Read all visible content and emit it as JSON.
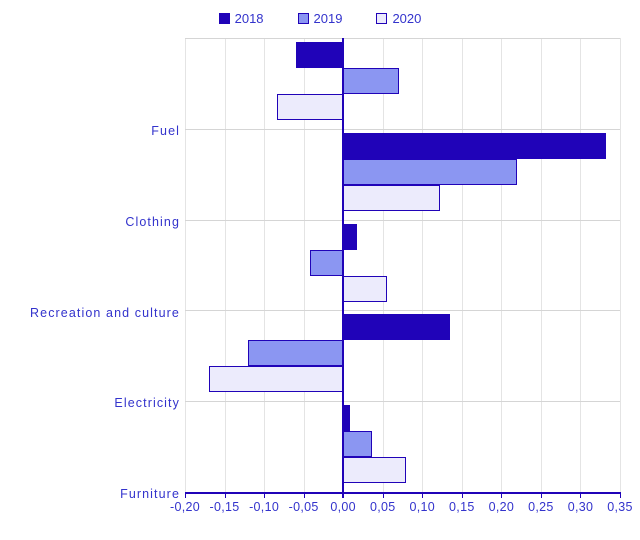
{
  "chart_data": {
    "type": "bar",
    "orientation": "horizontal",
    "title": "",
    "subtitle": "",
    "xlabel": "",
    "ylabel": "",
    "grid": true,
    "legend_position": "top-center",
    "xlim": [
      -0.2,
      0.35
    ],
    "xtick_step": 0.05,
    "xtick_labels": [
      "-0,20",
      "-0,15",
      "-0,10",
      "-0,05",
      "0,00",
      "0,05",
      "0,10",
      "0,15",
      "0,20",
      "0,25",
      "0,30",
      "0,35"
    ],
    "xtick_values": [
      -0.2,
      -0.15,
      -0.1,
      -0.05,
      0.0,
      0.05,
      0.1,
      0.15,
      0.2,
      0.25,
      0.3,
      0.35
    ],
    "categories": [
      "Fuel",
      "Clothing",
      "Recreation and culture",
      "Electricity",
      "Furniture"
    ],
    "series": [
      {
        "name": "2018",
        "color": "#2003b8",
        "values": [
          -0.06,
          0.332,
          0.018,
          0.135,
          0.009
        ]
      },
      {
        "name": "2019",
        "color": "#8b96f2",
        "values": [
          0.071,
          0.22,
          -0.042,
          -0.12,
          0.036
        ]
      },
      {
        "name": "2020",
        "color": "#ecebfc",
        "values": [
          -0.084,
          0.122,
          0.055,
          -0.17,
          0.08
        ]
      }
    ]
  },
  "legend": {
    "items": [
      {
        "label": "2018",
        "swatch": "legend-swatch-2018"
      },
      {
        "label": "2019",
        "swatch": "legend-swatch-2019"
      },
      {
        "label": "2020",
        "swatch": "legend-swatch-2020"
      }
    ]
  },
  "colors": {
    "series_2018": "#2003b8",
    "series_2019": "#8b96f2",
    "series_2020": "#ecebfc",
    "axis": "#2003b8",
    "text": "#3333cc",
    "gridline": "#d5d5d5",
    "background": "#ffffff"
  }
}
